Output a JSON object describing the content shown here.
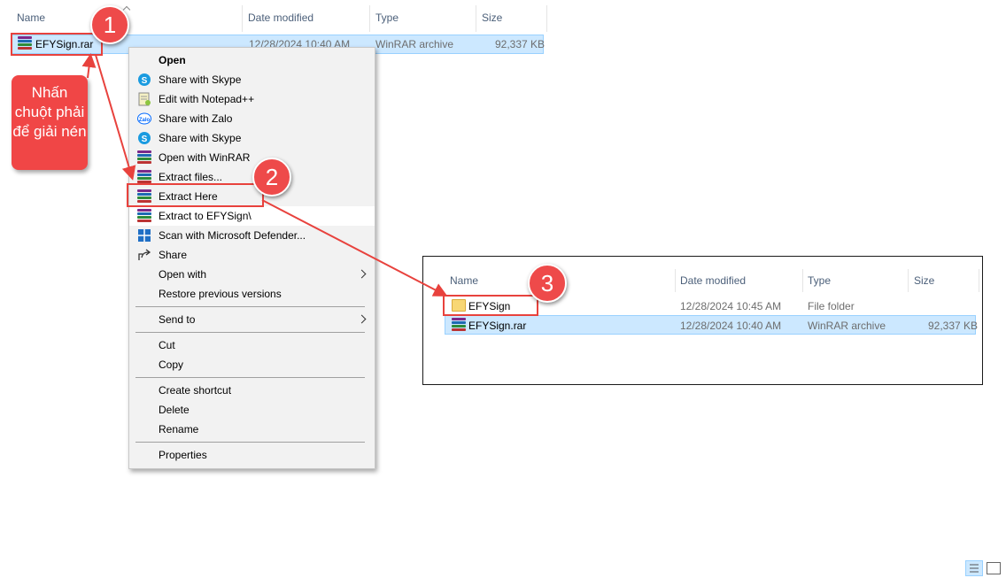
{
  "explorer": {
    "columns": {
      "name": "Name",
      "date": "Date modified",
      "type": "Type",
      "size": "Size"
    },
    "file": {
      "name": "EFYSign.rar",
      "date": "12/28/2024 10:40 AM",
      "type": "WinRAR archive",
      "size": "92,337 KB"
    }
  },
  "context_menu": {
    "items": [
      {
        "label": "Open",
        "icon": "none",
        "bold": true
      },
      {
        "label": "Share with Skype",
        "icon": "skype-icon"
      },
      {
        "label": "Edit with Notepad++",
        "icon": "notepad-plus-icon"
      },
      {
        "label": "Share with Zalo",
        "icon": "zalo-icon"
      },
      {
        "label": "Share with Skype",
        "icon": "skype-icon"
      },
      {
        "label": "Open with WinRAR",
        "icon": "winrar-icon"
      },
      {
        "label": "Extract files...",
        "icon": "winrar-icon"
      },
      {
        "label": "Extract Here",
        "icon": "winrar-icon"
      },
      {
        "label": "Extract to EFYSign\\",
        "icon": "winrar-icon",
        "highlighted": true
      },
      {
        "label": "Scan with Microsoft Defender...",
        "icon": "defender-icon"
      },
      {
        "label": "Share",
        "icon": "share-icon"
      },
      {
        "label": "Open with",
        "icon": "none",
        "submenu": true
      },
      {
        "label": "Restore previous versions",
        "icon": "none"
      },
      {
        "label": "Send to",
        "icon": "none",
        "submenu": true
      },
      {
        "label": "Cut",
        "icon": "none"
      },
      {
        "label": "Copy",
        "icon": "none"
      },
      {
        "label": "Create shortcut",
        "icon": "none"
      },
      {
        "label": "Delete",
        "icon": "none"
      },
      {
        "label": "Rename",
        "icon": "none"
      },
      {
        "label": "Properties",
        "icon": "none"
      }
    ]
  },
  "annotations": {
    "step1": "1",
    "step2": "2",
    "step3": "3",
    "callout_text": "Nhấn chuột phải để giải nén",
    "accent_color": "#ee4a4a"
  },
  "result_view": {
    "columns": {
      "name": "Name",
      "date": "Date modified",
      "type": "Type",
      "size": "Size"
    },
    "rows": [
      {
        "name": "EFYSign",
        "date": "12/28/2024 10:45 AM",
        "type": "File folder",
        "size": "",
        "icon": "folder-icon"
      },
      {
        "name": "EFYSign.rar",
        "date": "12/28/2024 10:40 AM",
        "type": "WinRAR archive",
        "size": "92,337 KB",
        "icon": "winrar-icon"
      }
    ]
  },
  "statusbar": {
    "view_icons": [
      "details-view-icon",
      "large-icons-view-icon"
    ]
  }
}
